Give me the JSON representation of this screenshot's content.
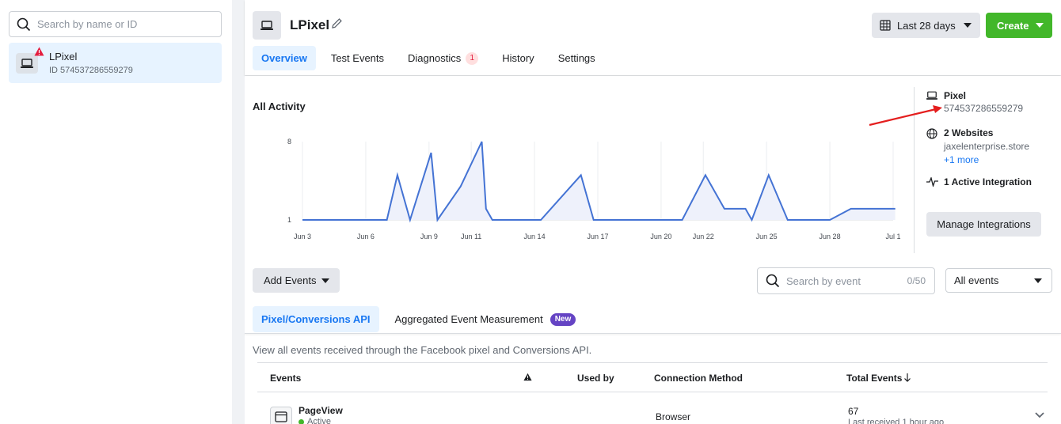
{
  "left_panel": {
    "search_placeholder": "Search by name or ID",
    "pixel": {
      "name": "LPixel",
      "id_text": "ID 574537286559279"
    }
  },
  "header": {
    "title": "LPixel",
    "date_range": "Last 28 days",
    "create_label": "Create",
    "tabs": [
      {
        "label": "Overview",
        "active": true
      },
      {
        "label": "Test Events"
      },
      {
        "label": "Diagnostics",
        "badge": "1"
      },
      {
        "label": "History"
      },
      {
        "label": "Settings"
      }
    ]
  },
  "activity": {
    "title": "All Activity"
  },
  "chart_data": {
    "type": "area",
    "title": "All Activity",
    "x_tick_labels": [
      "Jun 3",
      "Jun 6",
      "Jun 9",
      "Jun 11",
      "Jun 14",
      "Jun 17",
      "Jun 20",
      "Jun 22",
      "Jun 25",
      "Jun 28",
      "Jul 1"
    ],
    "y_tick_labels": [
      "8",
      "1"
    ],
    "ylim": [
      1,
      8
    ],
    "grid": "vertical",
    "color": "#4473d4",
    "fill_color": "#eef1fb",
    "x_day_of_june": [
      3,
      4,
      5,
      6,
      7,
      7.5,
      8.1,
      9.1,
      9.4,
      10.5,
      11.5,
      11.7,
      12,
      13,
      14.3,
      16.2,
      16.8,
      18,
      19,
      20,
      21,
      22.1,
      23,
      24,
      24.3,
      25.1,
      26,
      27,
      28,
      29,
      30,
      31.1
    ],
    "values": [
      1,
      1,
      1,
      1,
      1,
      5,
      1,
      7,
      1,
      4,
      8,
      2,
      1,
      1,
      1,
      5,
      1,
      1,
      1,
      1,
      1,
      5,
      2,
      2,
      1,
      5,
      1,
      1,
      1,
      2,
      2,
      2
    ]
  },
  "side_info": {
    "pixel_label": "Pixel",
    "pixel_id": "574537286559279",
    "websites_label": "2 Websites",
    "website": "jaxelenterprise.store",
    "more_link": "+1 more",
    "integration_label": "1 Active Integration",
    "manage_button": "Manage Integrations"
  },
  "toolbar": {
    "add_events": "Add Events",
    "search_placeholder": "Search by event",
    "search_count": "0/50",
    "filter_value": "All events"
  },
  "subtabs": [
    {
      "label": "Pixel/Conversions API",
      "active": true
    },
    {
      "label": "Aggregated Event Measurement",
      "badge": "New"
    }
  ],
  "description": "View all events received through the Facebook pixel and Conversions API.",
  "table": {
    "headers": {
      "events": "Events",
      "used_by": "Used by",
      "connection": "Connection Method",
      "total": "Total Events"
    },
    "rows": [
      {
        "name": "PageView",
        "status": "Active",
        "connection": "Browser",
        "total": "67",
        "last": "Last received 1 hour ago"
      }
    ]
  }
}
